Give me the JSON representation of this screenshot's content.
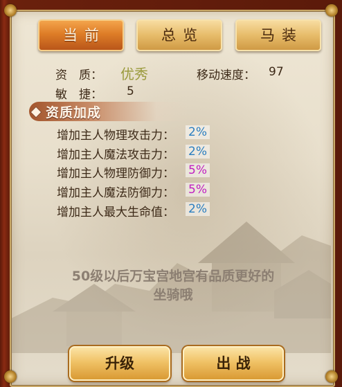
{
  "tabs": {
    "current": "当前",
    "overview": "总览",
    "horse_gear": "马装"
  },
  "info": {
    "quality_label": "资　质：",
    "quality_value": "优秀",
    "speed_label": "移动速度：",
    "speed_value": "97",
    "agility_label": "敏　捷：",
    "agility_value": "5"
  },
  "bonus": {
    "title": "资质加成",
    "rows": [
      {
        "label": "增加主人物理攻击力：",
        "value": "2%",
        "color": "#2a7ec0"
      },
      {
        "label": "增加主人魔法攻击力：",
        "value": "2%",
        "color": "#2a7ec0"
      },
      {
        "label": "增加主人物理防御力：",
        "value": "5%",
        "color": "#c020c0"
      },
      {
        "label": "增加主人魔法防御力：",
        "value": "5%",
        "color": "#c020c0"
      },
      {
        "label": "增加主人最大生命值：",
        "value": "2%",
        "color": "#2a7ec0"
      }
    ]
  },
  "hint": {
    "line1": "50级以后万宝宫地宫有品质更好的",
    "line2": "坐骑哦"
  },
  "buttons": {
    "upgrade": "升级",
    "deploy": "出 战"
  }
}
